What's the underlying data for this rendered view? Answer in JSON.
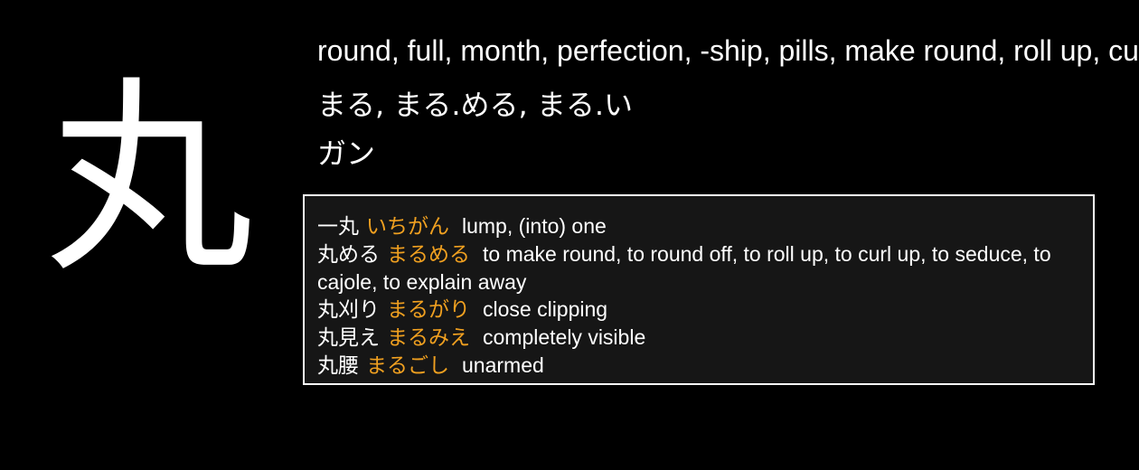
{
  "kanji": {
    "character": "丸",
    "meanings": "round, full, month, perfection, -ship, pills, make round, roll up, curl up, seduce, explain away, completely",
    "kun_readings": "まる, まる.める, まる.い",
    "on_readings": "ガン"
  },
  "vocabulary": [
    {
      "word": "一丸",
      "reading": "いちがん",
      "definition": "lump, (into) one"
    },
    {
      "word": "丸める",
      "reading": "まるめる",
      "definition": "to make round, to round off, to roll up, to curl up, to seduce, to cajole, to explain away"
    },
    {
      "word": "丸刈り",
      "reading": "まるがり",
      "definition": "close clipping"
    },
    {
      "word": "丸見え",
      "reading": "まるみえ",
      "definition": "completely visible"
    },
    {
      "word": "丸腰",
      "reading": "まるごし",
      "definition": "unarmed"
    }
  ],
  "colors": {
    "background": "#000000",
    "text": "#ffffff",
    "reading_accent": "#f0a020",
    "box_background": "#161616",
    "box_border": "#ffffff"
  }
}
